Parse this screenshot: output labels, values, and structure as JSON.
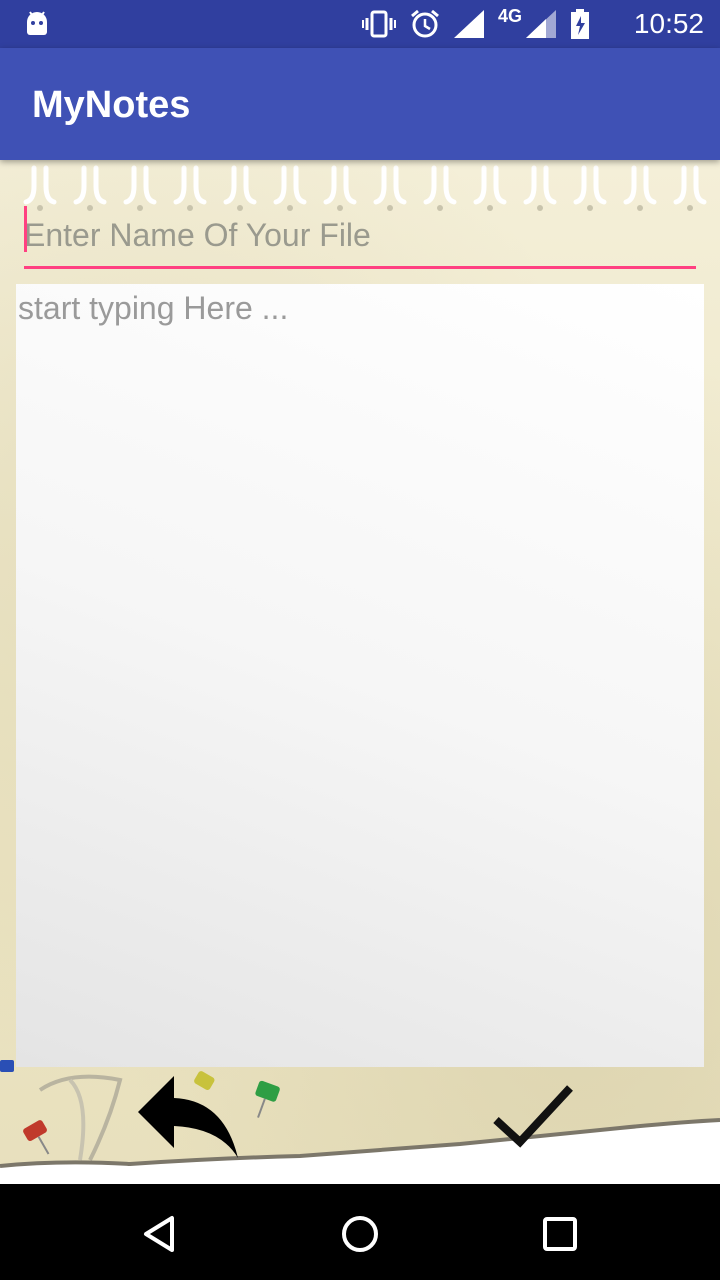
{
  "status_bar": {
    "time": "10:52",
    "network": "4G",
    "icons": [
      "android-icon",
      "vibrate-icon",
      "alarm-icon",
      "signal-icon",
      "signal-4g-icon",
      "battery-charging-icon"
    ]
  },
  "app_bar": {
    "title": "MyNotes"
  },
  "editor": {
    "file_name_placeholder": "Enter Name Of Your File",
    "file_name_value": "",
    "body_placeholder": "start typing Here ...",
    "body_value": ""
  },
  "actions": {
    "back_icon": "reply-arrow-icon",
    "save_icon": "checkmark-icon"
  },
  "nav_bar": {
    "icons": [
      "back-triangle-icon",
      "home-circle-icon",
      "recents-square-icon"
    ]
  },
  "colors": {
    "status_bar": "#303f9f",
    "app_bar": "#3f51b5",
    "accent": "#ff4081"
  }
}
